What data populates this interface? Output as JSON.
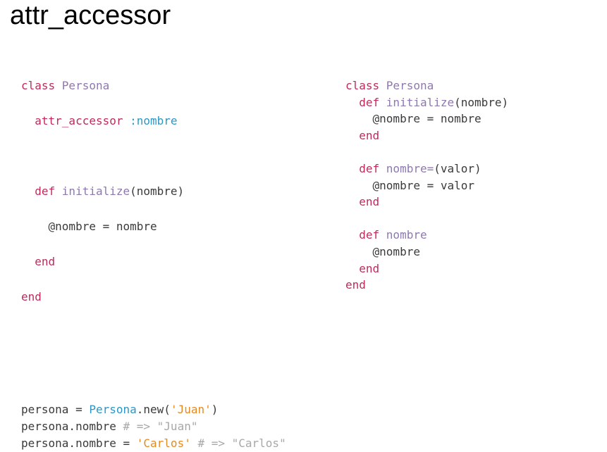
{
  "slide": {
    "title": "attr_accessor"
  },
  "code_blocks": {
    "left": [
      [
        {
          "t": "kw",
          "v": "class "
        },
        {
          "t": "cls",
          "v": "Persona"
        }
      ],
      [
        {
          "t": "txt",
          "v": "  "
        },
        {
          "t": "kw",
          "v": "attr_accessor "
        },
        {
          "t": "sym",
          "v": ":nombre"
        }
      ],
      [],
      [
        {
          "t": "txt",
          "v": "  "
        },
        {
          "t": "kw",
          "v": "def "
        },
        {
          "t": "cls",
          "v": "initialize"
        },
        {
          "t": "txt",
          "v": "(nombre)"
        }
      ],
      [
        {
          "t": "txt",
          "v": "    @nombre = nombre"
        }
      ],
      [
        {
          "t": "txt",
          "v": "  "
        },
        {
          "t": "kw",
          "v": "end"
        }
      ],
      [
        {
          "t": "kw",
          "v": "end"
        }
      ]
    ],
    "right": [
      [
        {
          "t": "kw",
          "v": "class "
        },
        {
          "t": "cls",
          "v": "Persona"
        }
      ],
      [
        {
          "t": "txt",
          "v": "  "
        },
        {
          "t": "kw",
          "v": "def "
        },
        {
          "t": "cls",
          "v": "initialize"
        },
        {
          "t": "txt",
          "v": "(nombre)"
        }
      ],
      [
        {
          "t": "txt",
          "v": "    @nombre = nombre"
        }
      ],
      [
        {
          "t": "txt",
          "v": "  "
        },
        {
          "t": "kw",
          "v": "end"
        }
      ],
      [],
      [
        {
          "t": "txt",
          "v": "  "
        },
        {
          "t": "kw",
          "v": "def "
        },
        {
          "t": "cls",
          "v": "nombre="
        },
        {
          "t": "txt",
          "v": "(valor)"
        }
      ],
      [
        {
          "t": "txt",
          "v": "    @nombre = valor"
        }
      ],
      [
        {
          "t": "txt",
          "v": "  "
        },
        {
          "t": "kw",
          "v": "end"
        }
      ],
      [],
      [
        {
          "t": "txt",
          "v": "  "
        },
        {
          "t": "kw",
          "v": "def "
        },
        {
          "t": "cls",
          "v": "nombre"
        }
      ],
      [
        {
          "t": "txt",
          "v": "    @nombre"
        }
      ],
      [
        {
          "t": "txt",
          "v": "  "
        },
        {
          "t": "kw",
          "v": "end"
        }
      ],
      [
        {
          "t": "kw",
          "v": "end"
        }
      ]
    ],
    "bottom": [
      [
        {
          "t": "txt",
          "v": "persona = "
        },
        {
          "t": "sym",
          "v": "Persona"
        },
        {
          "t": "txt",
          "v": ".new("
        },
        {
          "t": "str",
          "v": "'Juan'"
        },
        {
          "t": "txt",
          "v": ")"
        }
      ],
      [
        {
          "t": "txt",
          "v": "persona.nombre "
        },
        {
          "t": "cmt",
          "v": "# => \"Juan\""
        }
      ],
      [
        {
          "t": "txt",
          "v": "persona.nombre = "
        },
        {
          "t": "str",
          "v": "'Carlos'"
        },
        {
          "t": "txt",
          "v": " "
        },
        {
          "t": "cmt",
          "v": "# => \"Carlos\""
        }
      ]
    ]
  },
  "colors": {
    "keyword": "#c02a5c",
    "class_name": "#8e78b0",
    "symbol": "#2a97c7",
    "string": "#e58a1f",
    "comment": "#a8a8a8",
    "text": "#3a3a3a"
  }
}
